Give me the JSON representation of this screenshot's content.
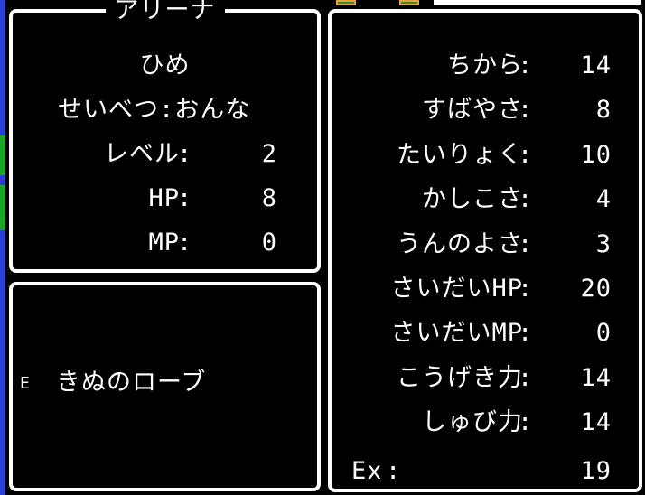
{
  "character": {
    "name": "アリーナ",
    "title": "ひめ",
    "gender_label": "せいべつ",
    "gender_value": "おんな"
  },
  "status": [
    {
      "label": "レベル",
      "value": "2"
    },
    {
      "label": "HP",
      "value": "8"
    },
    {
      "label": "MP",
      "value": "0"
    }
  ],
  "equipment": {
    "marker": "E",
    "item": "きぬのローブ"
  },
  "stats": [
    {
      "label": "ちから",
      "value": "14"
    },
    {
      "label": "すばやさ",
      "value": "8"
    },
    {
      "label": "たいりょく",
      "value": "10"
    },
    {
      "label": "かしこさ",
      "value": "4"
    },
    {
      "label": "うんのよさ",
      "value": "3"
    },
    {
      "label": "さいだいHP",
      "value": "20"
    },
    {
      "label": "さいだいMP",
      "value": "0"
    },
    {
      "label": "こうげき力",
      "value": "14"
    },
    {
      "label": "しゅび力",
      "value": "14"
    }
  ],
  "exp": {
    "label": "Ex",
    "value": "19"
  },
  "colon": ":",
  "colors": {
    "background": "#000000",
    "text": "#ffffff",
    "frame": "#ffffff",
    "border_strip": "#2b3fd6"
  }
}
